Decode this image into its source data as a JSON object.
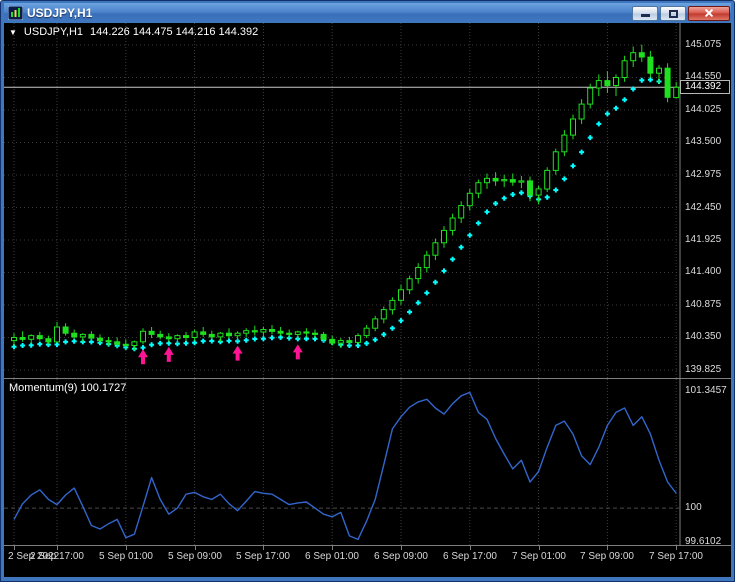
{
  "window": {
    "title": "USDJPY,H1"
  },
  "chart": {
    "info_symbol": "USDJPY,H1",
    "info_ohlc": "144.226 144.475 144.216 144.392",
    "price_scale": [
      "145.075",
      "144.550",
      "144.025",
      "143.500",
      "142.975",
      "142.450",
      "141.925",
      "141.400",
      "140.875",
      "140.350",
      "139.825"
    ],
    "current_price": "144.392"
  },
  "momentum": {
    "label": "Momentum(9) 100.1727",
    "scale_max": "101.3457",
    "level_label": "100",
    "scale_min": "99.6102"
  },
  "time_axis": [
    "2 Sep 2022",
    "2 Sep 17:00",
    "5 Sep 01:00",
    "5 Sep 09:00",
    "5 Sep 17:00",
    "6 Sep 01:00",
    "6 Sep 09:00",
    "6 Sep 17:00",
    "7 Sep 01:00",
    "7 Sep 09:00",
    "7 Sep 17:00"
  ],
  "colors": {
    "background": "#000000",
    "candle": "#1FE01F",
    "ma_line": "#00FFFF",
    "momentum_line": "#3366CC",
    "bid_line": "#C8C8C8",
    "grid": "#3C3C3C",
    "frame": "#7F7F7F",
    "arrow": "#FF1493",
    "scale_text": "#DCDCDC"
  },
  "chart_data": {
    "type": "candlestick",
    "symbol": "USDJPY",
    "timeframe": "H1",
    "ylim": [
      139.825,
      145.075
    ],
    "price_gridlines": [
      145.075,
      144.55,
      144.025,
      143.5,
      142.975,
      142.45,
      141.925,
      141.4,
      140.875,
      140.35,
      139.825
    ],
    "bid_price": 144.392,
    "time_label_indices": [
      0,
      5,
      13,
      21,
      29,
      37,
      45,
      53,
      61,
      69,
      77
    ],
    "arrow_indices": [
      15,
      18,
      26,
      33
    ],
    "candles": [
      [
        140.3,
        140.42,
        140.22,
        140.35
      ],
      [
        140.35,
        140.45,
        140.28,
        140.32
      ],
      [
        140.32,
        140.4,
        140.25,
        140.38
      ],
      [
        140.38,
        140.44,
        140.3,
        140.33
      ],
      [
        140.33,
        140.38,
        140.24,
        140.28
      ],
      [
        140.28,
        140.6,
        140.26,
        140.52
      ],
      [
        140.52,
        140.58,
        140.38,
        140.42
      ],
      [
        140.42,
        140.48,
        140.33,
        140.36
      ],
      [
        140.36,
        140.42,
        140.28,
        140.4
      ],
      [
        140.4,
        140.45,
        140.3,
        140.34
      ],
      [
        140.34,
        140.4,
        140.26,
        140.3
      ],
      [
        140.3,
        140.36,
        140.22,
        140.28
      ],
      [
        140.28,
        140.35,
        140.18,
        140.24
      ],
      [
        140.24,
        140.32,
        140.16,
        140.22
      ],
      [
        140.22,
        140.3,
        140.15,
        140.28
      ],
      [
        140.28,
        140.5,
        140.24,
        140.45
      ],
      [
        140.45,
        140.52,
        140.34,
        140.4
      ],
      [
        140.4,
        140.46,
        140.32,
        140.36
      ],
      [
        140.36,
        140.42,
        140.28,
        140.33
      ],
      [
        140.33,
        140.4,
        140.25,
        140.38
      ],
      [
        140.38,
        140.44,
        140.3,
        140.35
      ],
      [
        140.35,
        140.48,
        140.3,
        140.44
      ],
      [
        140.44,
        140.52,
        140.36,
        140.4
      ],
      [
        140.4,
        140.46,
        140.32,
        140.36
      ],
      [
        140.36,
        140.44,
        140.28,
        140.42
      ],
      [
        140.42,
        140.5,
        140.34,
        140.38
      ],
      [
        140.38,
        140.45,
        140.3,
        140.42
      ],
      [
        140.42,
        140.5,
        140.36,
        140.46
      ],
      [
        140.46,
        140.54,
        140.38,
        140.44
      ],
      [
        140.44,
        140.52,
        140.36,
        140.48
      ],
      [
        140.48,
        140.55,
        140.4,
        140.45
      ],
      [
        140.45,
        140.52,
        140.38,
        140.42
      ],
      [
        140.42,
        140.48,
        140.34,
        140.4
      ],
      [
        140.4,
        140.46,
        140.32,
        140.44
      ],
      [
        140.44,
        140.5,
        140.36,
        140.42
      ],
      [
        140.42,
        140.48,
        140.34,
        140.4
      ],
      [
        140.4,
        140.44,
        140.28,
        140.32
      ],
      [
        140.32,
        140.38,
        140.22,
        140.26
      ],
      [
        140.26,
        140.34,
        140.18,
        140.3
      ],
      [
        140.3,
        140.36,
        140.22,
        140.27
      ],
      [
        140.27,
        140.42,
        140.24,
        140.38
      ],
      [
        140.38,
        140.55,
        140.34,
        140.5
      ],
      [
        140.5,
        140.7,
        140.45,
        140.65
      ],
      [
        140.65,
        140.85,
        140.58,
        140.8
      ],
      [
        140.8,
        141.0,
        140.72,
        140.95
      ],
      [
        140.95,
        141.2,
        140.88,
        141.12
      ],
      [
        141.12,
        141.35,
        141.05,
        141.3
      ],
      [
        141.3,
        141.55,
        141.22,
        141.48
      ],
      [
        141.48,
        141.75,
        141.4,
        141.68
      ],
      [
        141.68,
        141.95,
        141.6,
        141.88
      ],
      [
        141.88,
        142.15,
        141.8,
        142.08
      ],
      [
        142.08,
        142.35,
        142.0,
        142.28
      ],
      [
        142.28,
        142.55,
        142.2,
        142.48
      ],
      [
        142.48,
        142.75,
        142.4,
        142.68
      ],
      [
        142.68,
        142.9,
        142.6,
        142.85
      ],
      [
        142.85,
        143.0,
        142.75,
        142.92
      ],
      [
        142.92,
        143.02,
        142.8,
        142.88
      ],
      [
        142.88,
        142.98,
        142.78,
        142.9
      ],
      [
        142.9,
        143.0,
        142.8,
        142.86
      ],
      [
        142.86,
        142.96,
        142.76,
        142.88
      ],
      [
        142.88,
        142.95,
        142.55,
        142.65
      ],
      [
        142.65,
        142.8,
        142.5,
        142.75
      ],
      [
        142.75,
        143.1,
        142.7,
        143.05
      ],
      [
        143.05,
        143.4,
        142.98,
        143.35
      ],
      [
        143.35,
        143.7,
        143.28,
        143.62
      ],
      [
        143.62,
        143.95,
        143.55,
        143.88
      ],
      [
        143.88,
        144.2,
        143.8,
        144.12
      ],
      [
        144.12,
        144.45,
        144.05,
        144.38
      ],
      [
        144.38,
        144.6,
        144.25,
        144.5
      ],
      [
        144.5,
        144.65,
        144.3,
        144.42
      ],
      [
        144.42,
        144.6,
        144.25,
        144.55
      ],
      [
        144.55,
        144.9,
        144.48,
        144.82
      ],
      [
        144.82,
        145.05,
        144.72,
        144.95
      ],
      [
        144.95,
        145.08,
        144.8,
        144.88
      ],
      [
        144.88,
        144.98,
        144.55,
        144.62
      ],
      [
        144.62,
        144.75,
        144.45,
        144.7
      ],
      [
        144.7,
        144.78,
        144.15,
        144.23
      ],
      [
        144.226,
        144.475,
        144.216,
        144.392
      ]
    ],
    "ma": {
      "name": "trailing moving average",
      "style": "cyan cross markers",
      "period": 5,
      "source": "low"
    },
    "momentum": {
      "period": 9,
      "last": 100.1727,
      "ylim": [
        99.6102,
        101.3457
      ],
      "level": 100,
      "values": [
        99.87,
        100.05,
        100.15,
        100.21,
        100.1,
        100.04,
        100.15,
        100.23,
        100.02,
        99.8,
        99.76,
        99.82,
        99.87,
        99.66,
        99.7,
        100.02,
        100.35,
        100.1,
        99.93,
        100.0,
        100.16,
        100.18,
        100.13,
        100.1,
        100.16,
        100.05,
        99.97,
        100.08,
        100.19,
        100.17,
        100.16,
        100.1,
        100.04,
        100.06,
        100.07,
        100.0,
        99.93,
        99.9,
        99.95,
        99.68,
        99.64,
        99.85,
        100.1,
        100.5,
        100.91,
        101.05,
        101.16,
        101.22,
        101.25,
        101.15,
        101.08,
        101.2,
        101.29,
        101.33,
        101.1,
        101.02,
        100.8,
        100.62,
        100.45,
        100.55,
        100.3,
        100.42,
        100.7,
        100.95,
        101.0,
        100.85,
        100.6,
        100.5,
        100.7,
        100.95,
        101.1,
        101.15,
        100.95,
        101.05,
        100.85,
        100.55,
        100.3,
        100.17
      ]
    }
  }
}
